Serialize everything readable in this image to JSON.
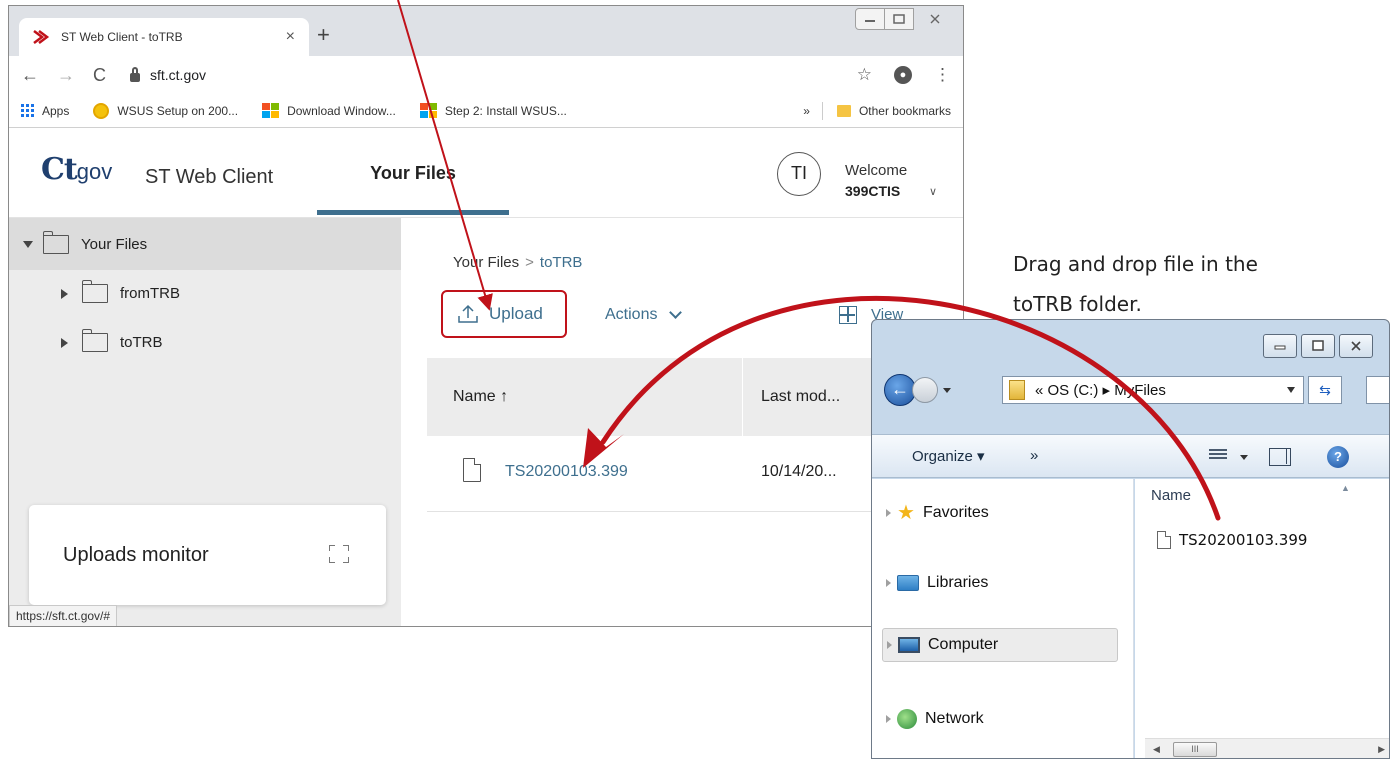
{
  "browser": {
    "tab_title": "ST Web Client - toTRB",
    "tab_close": "×",
    "new_tab": "+",
    "url": "sft.ct.gov",
    "status_url": "https://sft.ct.gov/#",
    "bookmarks": [
      {
        "label": "Apps",
        "icon": "apps-grid-icon"
      },
      {
        "label": "WSUS Setup on 200...",
        "icon": "wsus-icon"
      },
      {
        "label": "Download Window...",
        "icon": "windows-logo-icon"
      },
      {
        "label": "Step 2: Install WSUS...",
        "icon": "windows-logo-icon"
      }
    ],
    "bookmarks_more": "»",
    "other_bookmarks": "Other bookmarks"
  },
  "app": {
    "logo_main": "Ct",
    "logo_suffix": "gov",
    "name": "ST Web Client",
    "active_tab": "Your Files",
    "avatar_initials": "TI",
    "welcome": "Welcome",
    "username": "399CTIS",
    "sidebar": {
      "root": "Your Files",
      "items": [
        {
          "label": "fromTRB"
        },
        {
          "label": "toTRB"
        }
      ]
    },
    "uploads_monitor": "Uploads monitor",
    "breadcrumb": {
      "root": "Your Files",
      "separator": ">",
      "current": "toTRB"
    },
    "upload_label": "Upload",
    "actions_label": "Actions",
    "view_label": "View",
    "table": {
      "col_name": "Name",
      "col_modified": "Last mod...",
      "rows": [
        {
          "name": "TS20200103.399",
          "modified": "10/14/20..."
        }
      ]
    }
  },
  "callout": {
    "line1": "Drag and drop file in the",
    "line2": "toTRB folder."
  },
  "explorer": {
    "address": "« OS (C:) ▸ MyFiles",
    "organize": "Organize ▾",
    "cmd_more": "»",
    "nav": {
      "favorites": "Favorites",
      "libraries": "Libraries",
      "computer": "Computer",
      "network": "Network"
    },
    "col_name": "Name",
    "files": [
      {
        "name": "TS20200103.399"
      }
    ],
    "scroll_thumb": "III"
  },
  "colors": {
    "accent_blue": "#3e6f8e",
    "annotation_red": "#c0121a",
    "upload_border": "#c0121a"
  }
}
